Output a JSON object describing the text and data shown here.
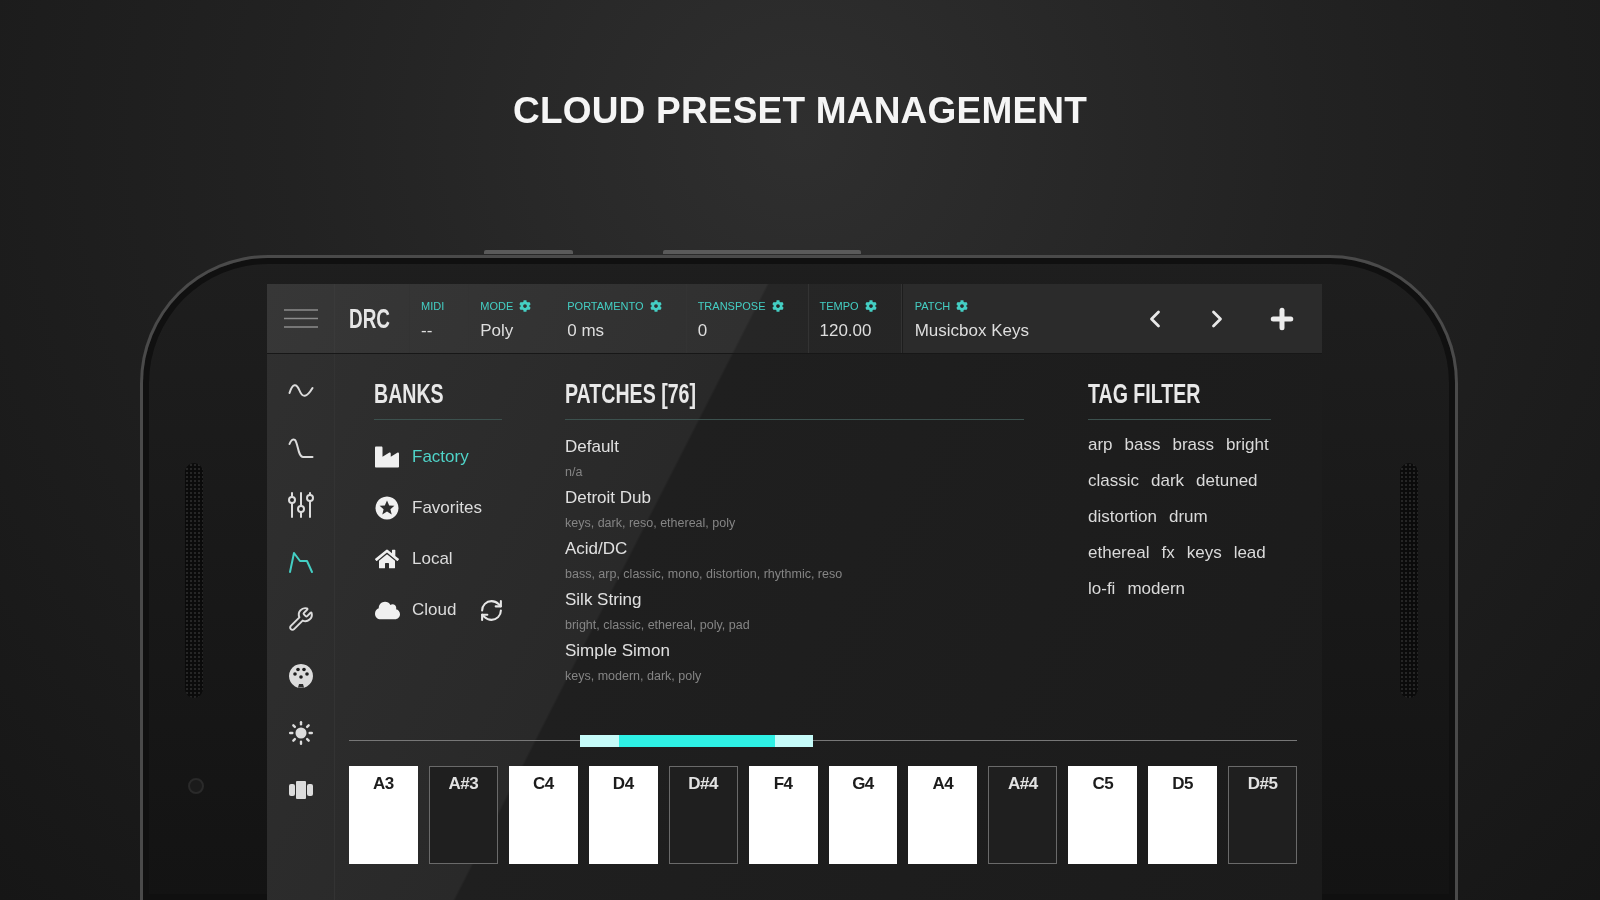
{
  "headline": "CLOUD PRESET MANAGEMENT",
  "top_bar": {
    "logo": "DRC",
    "params": [
      {
        "label": "MIDI",
        "value": "--",
        "settings_button": false
      },
      {
        "label": "MODE",
        "value": "Poly",
        "settings_button": true
      },
      {
        "label": "PORTAMENTO",
        "value": "0 ms",
        "settings_button": true
      },
      {
        "label": "TRANSPOSE",
        "value": "0",
        "settings_button": true
      },
      {
        "label": "TEMPO",
        "value": "120.00",
        "settings_button": true
      }
    ],
    "patch": {
      "label": "PATCH",
      "value": "Musicbox Keys",
      "settings_button": true
    }
  },
  "sidebar": {
    "items": [
      {
        "selected": false
      },
      {
        "selected": false
      },
      {
        "selected": false
      },
      {
        "selected": true
      },
      {
        "selected": false
      },
      {
        "selected": false
      },
      {
        "selected": false
      },
      {
        "selected": false
      }
    ]
  },
  "banks": {
    "title": "BANKS",
    "items": [
      {
        "label": "Factory",
        "selected": true,
        "sync_button": false
      },
      {
        "label": "Favorites",
        "selected": false,
        "sync_button": false
      },
      {
        "label": "Local",
        "selected": false,
        "sync_button": false
      },
      {
        "label": "Cloud",
        "selected": false,
        "sync_button": true
      }
    ]
  },
  "patches": {
    "title": "PATCHES [76]",
    "items": [
      {
        "name": "Default",
        "tags": "n/a",
        "selected": false
      },
      {
        "name": "Detroit Dub",
        "tags": "keys, dark, reso, ethereal, poly",
        "selected": false
      },
      {
        "name": "Acid/DC",
        "tags": "bass, arp, classic, mono, distortion, rhythmic, reso",
        "selected": false
      },
      {
        "name": "Silk String",
        "tags": "bright, classic, ethereal, poly, pad",
        "selected": false
      },
      {
        "name": "Simple Simon",
        "tags": "keys, modern, dark, poly",
        "selected": false
      }
    ]
  },
  "tag_filter": {
    "title": "TAG FILTER",
    "rows": [
      [
        {
          "label": "arp",
          "selected": false
        },
        {
          "label": "bass",
          "selected": false
        },
        {
          "label": "brass",
          "selected": false
        },
        {
          "label": "bright",
          "selected": false
        }
      ],
      [
        {
          "label": "classic",
          "selected": false
        },
        {
          "label": "dark",
          "selected": false
        },
        {
          "label": "detuned",
          "selected": false
        }
      ],
      [
        {
          "label": "distortion",
          "selected": false
        },
        {
          "label": "drum",
          "selected": false
        }
      ],
      [
        {
          "label": "ethereal",
          "selected": false
        },
        {
          "label": "fx",
          "selected": false
        },
        {
          "label": "keys",
          "selected": false
        },
        {
          "label": "lead",
          "selected": false
        }
      ],
      [
        {
          "label": "lo-fi",
          "selected": false
        },
        {
          "label": "modern",
          "selected": false
        }
      ]
    ]
  },
  "keyboard": {
    "keys": [
      {
        "note": "A3",
        "kind": "white"
      },
      {
        "note": "A#3",
        "kind": "black"
      },
      {
        "note": "C4",
        "kind": "white"
      },
      {
        "note": "D4",
        "kind": "white"
      },
      {
        "note": "D#4",
        "kind": "black"
      },
      {
        "note": "F4",
        "kind": "white"
      },
      {
        "note": "G4",
        "kind": "white"
      },
      {
        "note": "A4",
        "kind": "white"
      },
      {
        "note": "A#4",
        "kind": "black"
      },
      {
        "note": "C5",
        "kind": "white"
      },
      {
        "note": "D5",
        "kind": "white"
      },
      {
        "note": "D#5",
        "kind": "black"
      }
    ]
  }
}
